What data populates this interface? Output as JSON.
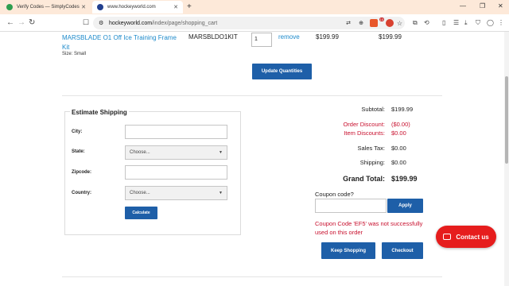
{
  "browser": {
    "tabs": [
      {
        "title": "Verify Codes — SimplyCodes",
        "active": false
      },
      {
        "title": "www.hockeyworld.com",
        "active": true
      }
    ],
    "url_host": "hockeyworld.com",
    "url_path": "/index/page/shopping_cart",
    "badge_count": "10"
  },
  "cart": {
    "item": {
      "name": "MARSBLADE O1 Off Ice Training Frame Kit",
      "size": "Size: Small",
      "sku": "MARSBLDO1KIT",
      "qty": "1",
      "remove_label": "remove",
      "price": "$199.99",
      "total": "$199.99"
    },
    "update_label": "Update Quantities"
  },
  "shipping": {
    "title": "Estimate Shipping",
    "city_label": "City:",
    "state_label": "State:",
    "state_value": "Choose...",
    "zip_label": "Zipcode:",
    "country_label": "Country:",
    "country_value": "Choose...",
    "calc_label": "Calculate"
  },
  "summary": {
    "subtotal_label": "Subtotal:",
    "subtotal": "$199.99",
    "order_discount_label": "Order Discount:",
    "order_discount": "($0.00)",
    "item_discounts_label": "Item Discounts:",
    "item_discounts": "$0.00",
    "tax_label": "Sales Tax:",
    "tax": "$0.00",
    "shipping_label": "Shipping:",
    "shipping": "$0.00",
    "grand_label": "Grand Total:",
    "grand": "$199.99"
  },
  "coupon": {
    "label": "Coupon code?",
    "apply_label": "Apply",
    "message": "Coupon Code 'EF5' was not successfully used on this order"
  },
  "actions": {
    "keep_shopping": "Keep Shopping",
    "checkout": "Checkout",
    "contact": "Contact us"
  },
  "colors": {
    "accent": "#1e5fa8",
    "error": "#c8102e",
    "contact": "#e61d1d",
    "link": "#1d8acb"
  }
}
